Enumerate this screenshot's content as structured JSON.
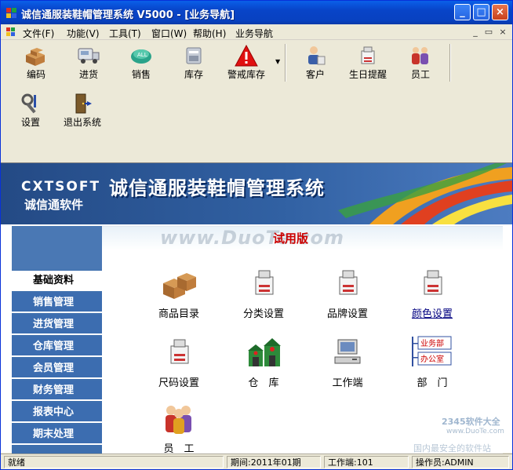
{
  "window": {
    "title": "诚信通服装鞋帽管理系统 V5000 - [业务导航]",
    "controls": {
      "minimize": "_",
      "maximize": "□",
      "close": "×"
    }
  },
  "menubar": {
    "items": [
      "文件(F)",
      "功能(V)",
      "工具(T)",
      "窗口(W)",
      "帮助(H)",
      "业务导航"
    ],
    "mdi": {
      "minimize": "_",
      "restore": "▭",
      "close": "×"
    }
  },
  "toolbar": {
    "row1": [
      {
        "label": "编码",
        "icon": "boxes-icon"
      },
      {
        "label": "进货",
        "icon": "truck-icon"
      },
      {
        "label": "销售",
        "icon": "sales-icon"
      },
      {
        "label": "库存",
        "icon": "warehouse-icon"
      },
      {
        "label": "警戒库存",
        "icon": "warning-icon"
      },
      {
        "label": "客户",
        "icon": "customer-icon"
      },
      {
        "label": "生日提醒",
        "icon": "birthday-icon"
      },
      {
        "label": "员工",
        "icon": "staff-icon"
      }
    ],
    "row2": [
      {
        "label": "设置",
        "icon": "tools-icon"
      },
      {
        "label": "退出系统",
        "icon": "exit-door-icon"
      }
    ]
  },
  "banner": {
    "brand_en": "CXTSOFT",
    "brand_cn": "诚信通软件",
    "title": "诚信通服装鞋帽管理系统"
  },
  "content_header": {
    "watermark": "www.DuoTe.com",
    "trial": "试用版"
  },
  "sidenav": {
    "items": [
      "基础资料",
      "销售管理",
      "进货管理",
      "仓库管理",
      "会员管理",
      "财务管理",
      "报表中心",
      "期末处理"
    ],
    "active": "基础资料"
  },
  "modules": [
    {
      "label": "商品目录",
      "icon": "product-boxes-icon"
    },
    {
      "label": "分类设置",
      "icon": "category-printer-icon"
    },
    {
      "label": "品牌设置",
      "icon": "brand-printer-icon"
    },
    {
      "label": "颜色设置",
      "icon": "color-printer-icon"
    },
    {
      "label": "尺码设置",
      "icon": "size-printer-icon"
    },
    {
      "label": "仓　库",
      "icon": "warehouse-building-icon"
    },
    {
      "label": "工作端",
      "icon": "computer-icon"
    },
    {
      "label": "部　门",
      "icon": "department-icon",
      "dept_labels": [
        "业务部",
        "办公室"
      ]
    },
    {
      "label": "员　工",
      "icon": "employees-icon"
    }
  ],
  "statusbar": {
    "ready": "就绪",
    "period": "期间:2011年01期",
    "workstation": "工作端:101",
    "operator": "操作员:ADMIN"
  },
  "corner_watermark": {
    "line1": "2345软件大全",
    "line2": "www.DuoTe.com",
    "line3": "国内最安全的软件站"
  },
  "colors": {
    "titlebar": "#0844c8",
    "nav": "#3c6db0",
    "trial": "#cc0000",
    "link": "#000080"
  }
}
